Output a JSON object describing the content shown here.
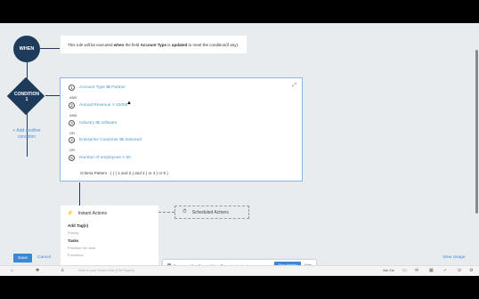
{
  "when": {
    "node_label": "WHEN",
    "card_text_1": "This rule will be executed ",
    "card_bold_1": "when",
    "card_text_2": " the field ",
    "card_bold_2": "Account Type",
    "card_text_3": " is ",
    "card_bold_3": "updated",
    "card_text_4": " to meet the condition(if any)."
  },
  "condition": {
    "node_label": "CONDITION",
    "node_number": "1",
    "add_label": "+ Add another condition",
    "criteria": [
      {
        "num": "1",
        "field": "Account Type",
        "op": "IS",
        "value": "Partner"
      },
      {
        "num": "2",
        "field": "Annual Revenue",
        "op": ">",
        "value": "10000"
      },
      {
        "num": "3",
        "field": "Industry",
        "op": "IS",
        "value": "software"
      },
      {
        "num": "4",
        "field": "Enterprise Customer",
        "op": "IS",
        "value": "Selected"
      },
      {
        "num": "5",
        "field": "Number of employees",
        "op": ">",
        "value": "50"
      }
    ],
    "operators": [
      "AND",
      "AND",
      "OR",
      "OR"
    ],
    "criteria_pattern_label": "Criteria Pattern :",
    "criteria_pattern": "( ( ( 1 and 2 ) and 3 ) or 4 ) or 5 )"
  },
  "actions": {
    "instant_label": "Instant Actions",
    "scheduled_label": "Scheduled Actions",
    "sections": [
      {
        "title": "Add Tag(s)",
        "sub": "Priority"
      },
      {
        "title": "Tasks",
        "sub": "Prioritize the deal"
      },
      {
        "title": "",
        "sub": "Functions"
      }
    ]
  },
  "footer": {
    "save_label": "Save",
    "cancel_label": "Cancel",
    "view_usage_label": "View Usage"
  },
  "share_bar": {
    "message": "Screencastify - Screen Video Recorder is sharing your screen.",
    "stop_label": "Stop sharing",
    "hide_label": "Hide"
  },
  "taskbar": {
    "search_hint": "Here is your Smart Chat (Ctrl+Space)",
    "zoom": "Ask Zia"
  },
  "colors": {
    "node": "#1f3b5c",
    "accent": "#3b86d6",
    "criteria_text": "#4a9cc9"
  }
}
